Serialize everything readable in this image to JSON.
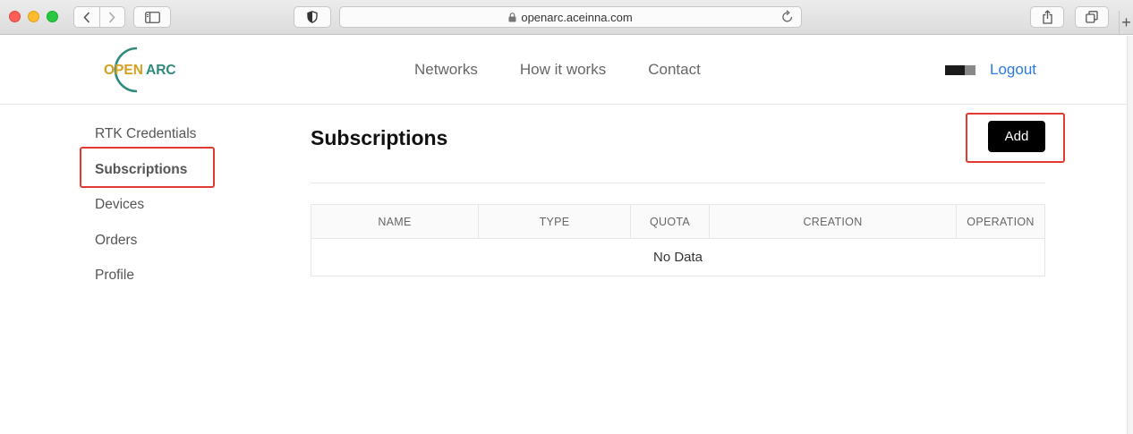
{
  "browser": {
    "url": "openarc.aceinna.com"
  },
  "header": {
    "logo": {
      "part1": "OPEN",
      "part2": "ARC",
      "color1": "#d4a01f",
      "color2": "#2f8a7d"
    },
    "nav": [
      {
        "label": "Networks"
      },
      {
        "label": "How it works"
      },
      {
        "label": "Contact"
      }
    ],
    "logout_label": "Logout"
  },
  "sidebar": {
    "items": [
      {
        "label": "RTK Credentials",
        "active": false
      },
      {
        "label": "Subscriptions",
        "active": true
      },
      {
        "label": "Devices",
        "active": false
      },
      {
        "label": "Orders",
        "active": false
      },
      {
        "label": "Profile",
        "active": false
      }
    ]
  },
  "main": {
    "title": "Subscriptions",
    "add_label": "Add",
    "table": {
      "columns": [
        "NAME",
        "TYPE",
        "QUOTA",
        "CREATION",
        "OPERATION"
      ],
      "empty_text": "No Data"
    }
  },
  "colors": {
    "accent_link": "#2a7ae2",
    "highlight_box": "#e03a32",
    "primary_button": "#000000"
  }
}
